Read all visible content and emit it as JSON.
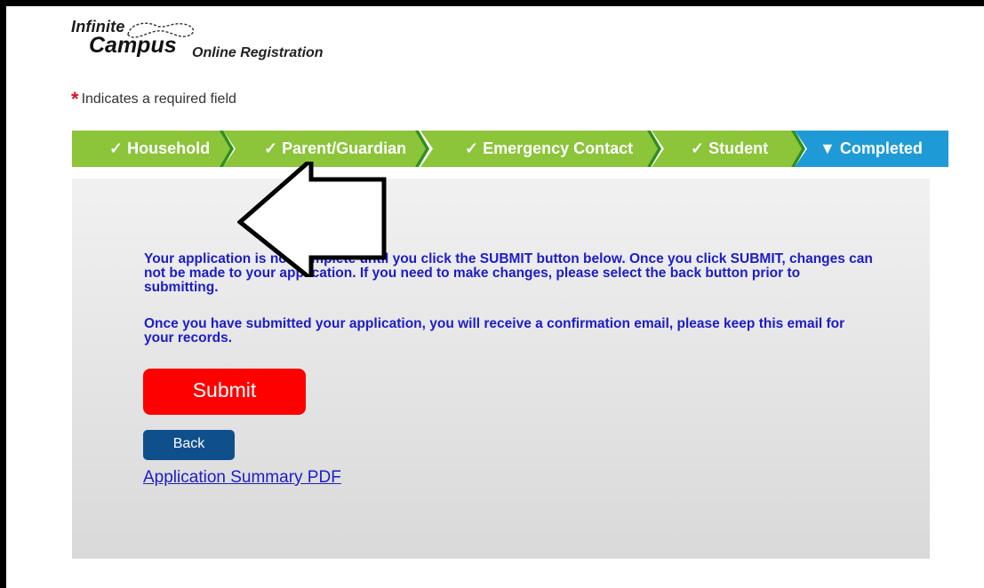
{
  "header": {
    "logo_line1": "Infinite",
    "logo_line2": "Campus",
    "subtitle": "Online Registration"
  },
  "required_note": {
    "star": "*",
    "text": "Indicates a required field"
  },
  "steps": [
    {
      "label": "Household",
      "status": "done"
    },
    {
      "label": "Parent/Guardian",
      "status": "done"
    },
    {
      "label": "Emergency Contact",
      "status": "done"
    },
    {
      "label": "Student",
      "status": "done"
    },
    {
      "label": "Completed",
      "status": "current"
    }
  ],
  "step_icons": {
    "done": "✓",
    "current": "▼"
  },
  "content": {
    "message1": "Your application is not complete until you click the SUBMIT button below. Once you click SUBMIT, changes can not be made to your application. If you need to make changes, please select the back button prior to submitting.",
    "message2": "Once you have submitted your application, you will receive a confirmation email, please keep this email for your records.",
    "submit_label": "Submit",
    "back_label": "Back",
    "pdf_link": "Application Summary PDF"
  },
  "annotation": {
    "icon": "left-arrow-icon"
  },
  "colors": {
    "step_done": "#8cc43a",
    "step_done_dark": "#2f8f1f",
    "step_current": "#1e9bd7",
    "submit": "#ff0000",
    "back": "#0f4f8c",
    "message": "#1c1cc9",
    "required_star": "#e0101a"
  }
}
